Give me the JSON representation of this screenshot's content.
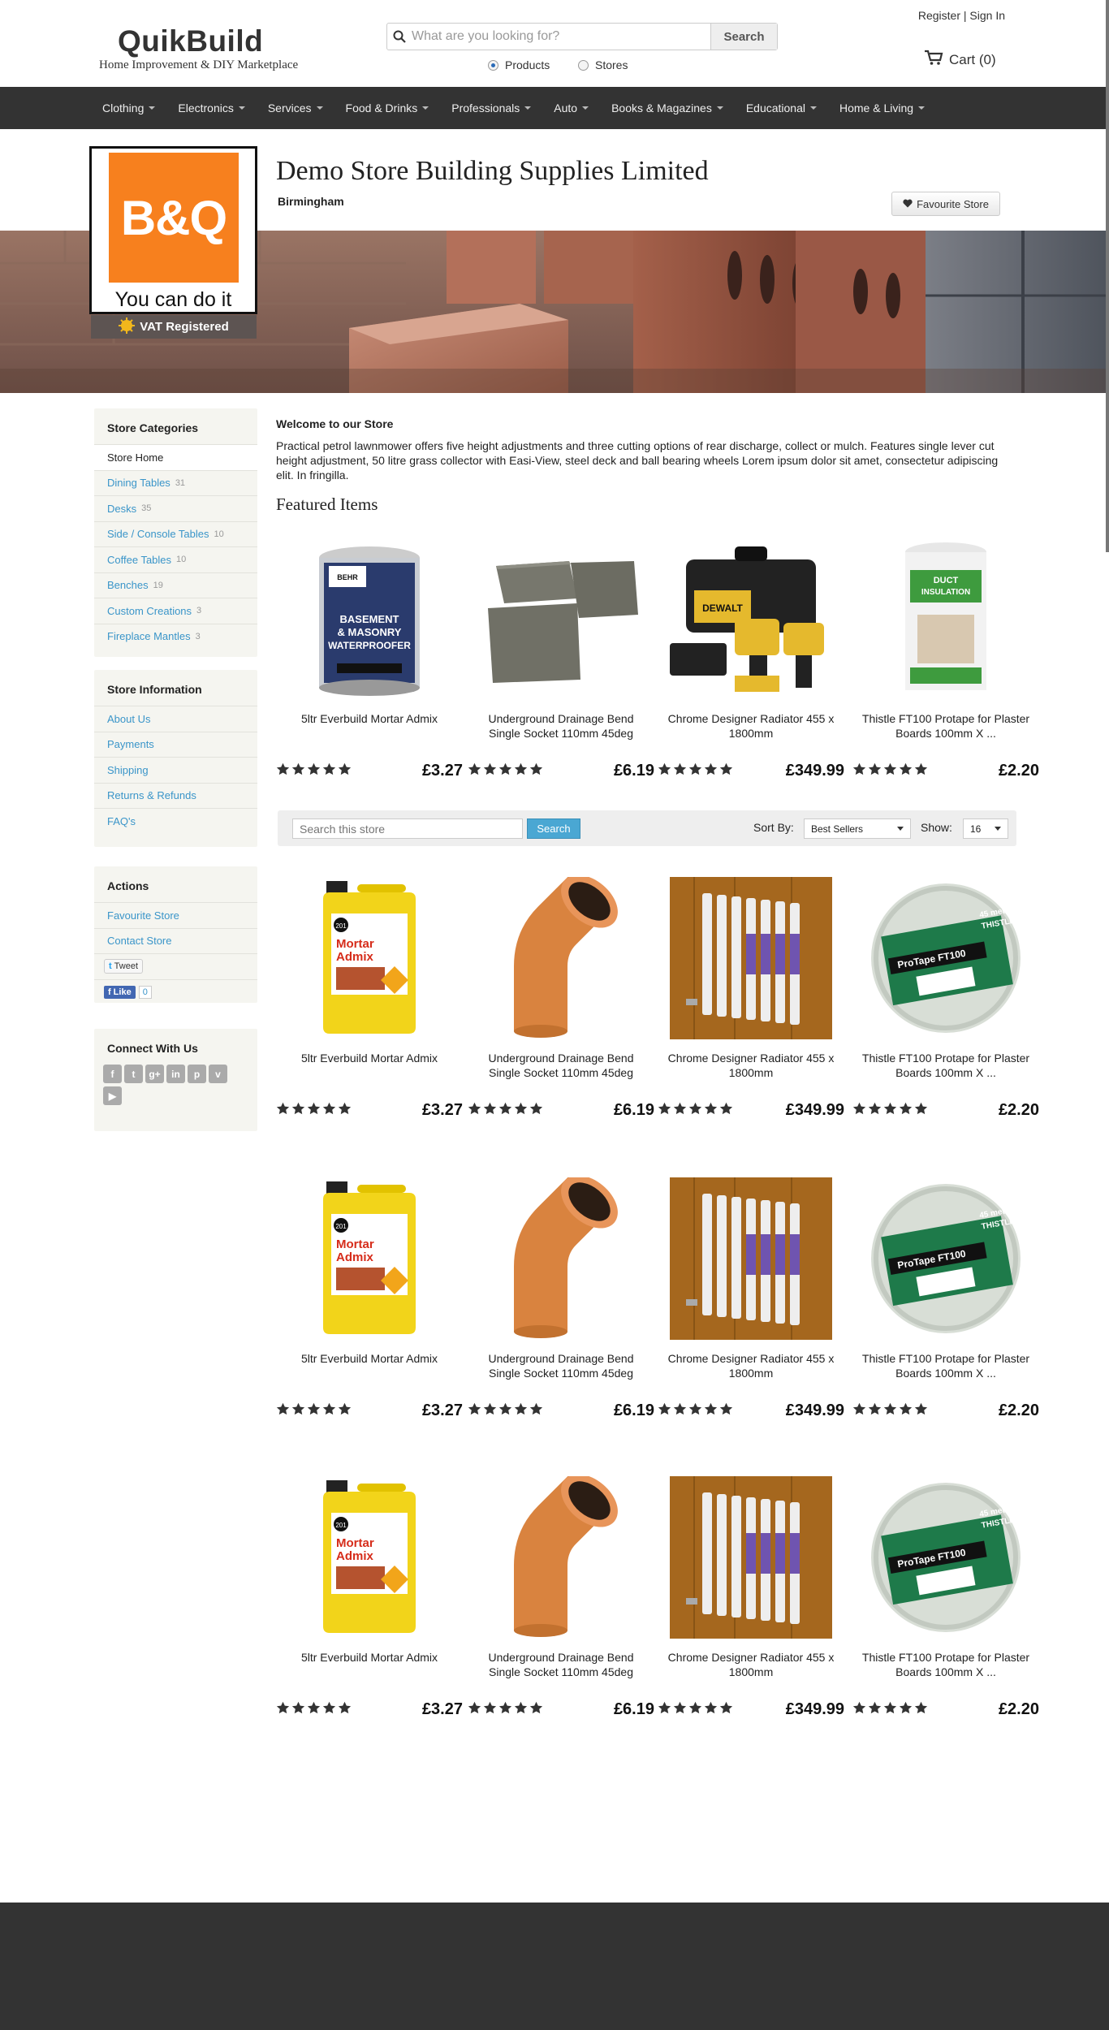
{
  "site": {
    "name": "QuikBuild",
    "tagline": "Home Improvement & DIY Marketplace"
  },
  "search": {
    "placeholder": "What are you looking for?",
    "button": "Search",
    "options": [
      "Products",
      "Stores"
    ],
    "selected": "Products"
  },
  "auth": {
    "register": "Register",
    "separator": "|",
    "sign_in": "Sign In"
  },
  "cart": {
    "label": "Cart (0)"
  },
  "nav": [
    "Clothing",
    "Electronics",
    "Services",
    "Food & Drinks",
    "Professionals",
    "Auto",
    "Books & Magazines",
    "Educational",
    "Home & Living"
  ],
  "store": {
    "name": "Demo Store Building Supplies Limited",
    "city": "Birmingham",
    "logo_text": "B&Q",
    "logo_tagline": "You can do it",
    "vat": "VAT Registered",
    "favourite_button": "Favourite Store"
  },
  "sidebar": {
    "categories_title": "Store Categories",
    "categories": [
      {
        "label": "Store Home",
        "count": ""
      },
      {
        "label": "Dining Tables",
        "count": "31"
      },
      {
        "label": "Desks",
        "count": "35"
      },
      {
        "label": "Side / Console Tables",
        "count": "10"
      },
      {
        "label": "Coffee Tables",
        "count": "10"
      },
      {
        "label": "Benches",
        "count": "19"
      },
      {
        "label": "Custom Creations",
        "count": "3"
      },
      {
        "label": "Fireplace Mantles",
        "count": "3"
      }
    ],
    "info_title": "Store Information",
    "info": [
      "About Us",
      "Payments",
      "Shipping",
      "Returns & Refunds",
      "FAQ's"
    ],
    "actions_title": "Actions",
    "actions": [
      "Favourite Store",
      "Contact Store"
    ],
    "tweet": "Tweet",
    "like": "Like",
    "like_count": "0",
    "connect_title": "Connect With Us",
    "social_icons": [
      "facebook-icon",
      "twitter-icon",
      "google-plus-icon",
      "linkedin-icon",
      "pinterest-icon",
      "vimeo-icon",
      "youtube-icon"
    ]
  },
  "welcome": {
    "title": "Welcome to our Store",
    "text": "Practical petrol lawnmower offers five height adjustments and three cutting options of rear discharge, collect or mulch. Features single lever cut height adjustment, 50 litre grass collector with Easi-View, steel deck and ball bearing wheels Lorem ipsum dolor sit amet, consectetur adipiscing elit. In fringilla."
  },
  "featured_title": "Featured Items",
  "featured": [
    {
      "title": "5ltr Everbuild Mortar Admix",
      "price": "£3.27",
      "rating": 5,
      "image": "paint-tin",
      "label": "BASEMENT & MASONRY WATERPROOFER",
      "brand": "BEHR PREMIUM"
    },
    {
      "title": "Underground Drainage Bend Single Socket 110mm 45deg",
      "price": "£6.19",
      "rating": 5,
      "image": "paving-slabs"
    },
    {
      "title": "Chrome Designer Radiator 455 x 1800mm",
      "price": "£349.99",
      "rating": 5,
      "image": "drill-kit",
      "brand": "DEWALT"
    },
    {
      "title": "Thistle FT100 Protape for Plaster Boards 100mm X ...",
      "price": "£2.20",
      "rating": 5,
      "image": "insulation-roll",
      "label": "DUCT INSULATION"
    }
  ],
  "toolbar": {
    "search_placeholder": "Search this store",
    "search_button": "Search",
    "sort_label": "Sort By:",
    "sort_value": "Best Sellers",
    "show_label": "Show:",
    "show_value": "16"
  },
  "products": [
    {
      "title": "5ltr Everbuild Mortar Admix",
      "price": "£3.27",
      "rating": 5,
      "image": "mortar-admix",
      "brand": "201",
      "label": "Mortar Admix"
    },
    {
      "title": "Underground Drainage Bend Single Socket 110mm 45deg",
      "price": "£6.19",
      "rating": 5,
      "image": "pipe-bend"
    },
    {
      "title": "Chrome Designer Radiator 455 x 1800mm",
      "price": "£349.99",
      "rating": 5,
      "image": "radiator"
    },
    {
      "title": "Thistle FT100 Protape for Plaster Boards 100mm X ...",
      "price": "£2.20",
      "rating": 5,
      "image": "tape-roll",
      "brand": "THISTLE",
      "label": "ProTape FT100",
      "length": "45 metres"
    }
  ],
  "product_rows": 3,
  "colors": {
    "nav_bg": "#333333",
    "accent_blue": "#3a95c9",
    "bq_orange": "#f7801e",
    "footer_bg": "#333333"
  }
}
